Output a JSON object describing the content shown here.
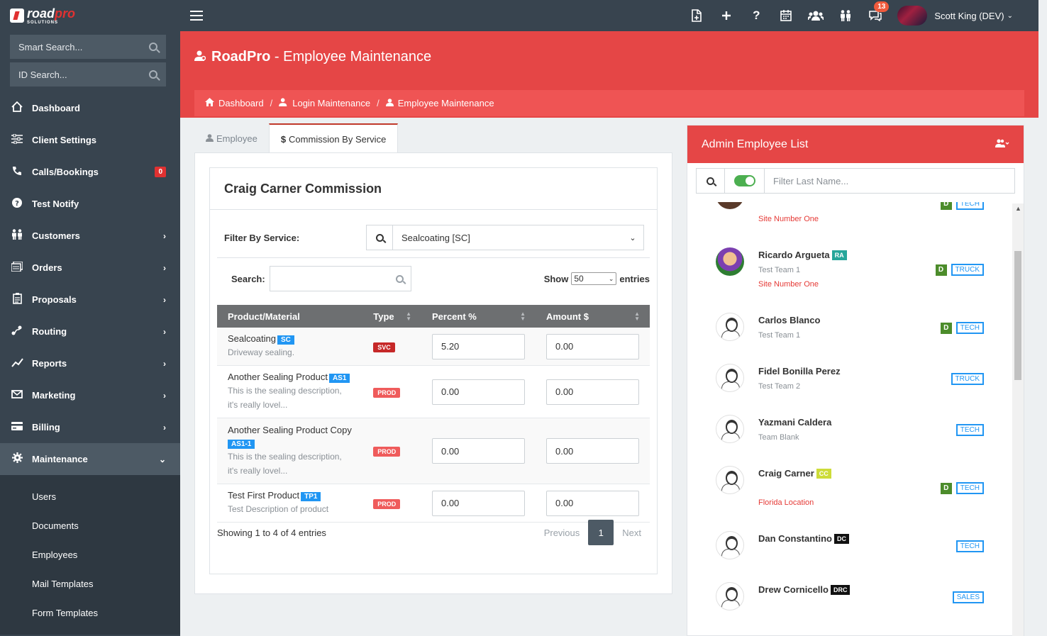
{
  "app": {
    "logo_main_a": "road",
    "logo_main_b": "pro",
    "logo_sub": "SOLUTIONS"
  },
  "topbar": {
    "notification_count": "13",
    "user_name": "Scott King (DEV)",
    "icons": [
      "new-document-icon",
      "plus-icon",
      "help-icon",
      "calendar-icon",
      "users-icon",
      "people-icon",
      "chat-icon"
    ]
  },
  "sidebar": {
    "smart_search": "Smart Search...",
    "id_search": "ID Search...",
    "items": [
      {
        "label": "Dashboard",
        "icon": "home-icon"
      },
      {
        "label": "Client Settings",
        "icon": "sliders-icon"
      },
      {
        "label": "Calls/Bookings",
        "icon": "phone-icon",
        "count": "0"
      },
      {
        "label": "Test Notify",
        "icon": "question-icon"
      },
      {
        "label": "Customers",
        "icon": "people-icon"
      },
      {
        "label": "Orders",
        "icon": "orders-icon"
      },
      {
        "label": "Proposals",
        "icon": "clipboard-icon"
      },
      {
        "label": "Routing",
        "icon": "route-icon"
      },
      {
        "label": "Reports",
        "icon": "chart-line-icon"
      },
      {
        "label": "Marketing",
        "icon": "envelope-icon"
      },
      {
        "label": "Billing",
        "icon": "credit-card-icon"
      },
      {
        "label": "Maintenance",
        "icon": "gear-icon"
      }
    ],
    "sub_items": [
      "Users",
      "Documents",
      "Employees",
      "Mail Templates",
      "Form Templates"
    ]
  },
  "header": {
    "title_brand": "RoadPro",
    "title_rest": " - Employee Maintenance",
    "breadcrumb": [
      "Dashboard",
      "Login Maintenance",
      "Employee Maintenance"
    ],
    "sep": "/"
  },
  "tabs": [
    {
      "label": "Employee"
    },
    {
      "label": "Commission By Service"
    }
  ],
  "commission": {
    "title": "Craig Carner Commission",
    "filter_label": "Filter By Service:",
    "filter_value": "Sealcoating [SC]",
    "search_label": "Search:",
    "show_label": "Show",
    "show_value": "50",
    "entries_label": "entries",
    "columns": [
      "Product/Material",
      "Type",
      "Percent %",
      "Amount $"
    ],
    "rows": [
      {
        "name": "Sealcoating",
        "code": "SC",
        "desc1": "Driveway sealing.",
        "desc2": "",
        "type": "SVC",
        "percent": "5.20",
        "amount": "0.00"
      },
      {
        "name": "Another Sealing Product",
        "code": "AS1",
        "desc1": "This is the sealing description,",
        "desc2": "it's really lovel...",
        "type": "PROD",
        "percent": "0.00",
        "amount": "0.00"
      },
      {
        "name": "Another Sealing Product Copy",
        "code": "AS1-1",
        "desc1": "This is the sealing description,",
        "desc2": "it's really lovel...",
        "type": "PROD",
        "percent": "0.00",
        "amount": "0.00"
      },
      {
        "name": "Test First Product",
        "code": "TP1",
        "desc1": "Test Description of product",
        "desc2": "",
        "type": "PROD",
        "percent": "0.00",
        "amount": "0.00"
      }
    ],
    "showing": "Showing 1 to 4 of 4 entries",
    "prev": "Previous",
    "page": "1",
    "next": "Next"
  },
  "employees": {
    "title": "Admin Employee List",
    "filter_placeholder": "Filter Last Name...",
    "list": [
      {
        "name": "",
        "initials": "",
        "team": "",
        "location": "Site Number One",
        "d": "D",
        "role": "TECH"
      },
      {
        "name": "Ricardo Argueta",
        "initials": "RA",
        "team": "Test Team 1",
        "location": "Site Number One",
        "d": "D",
        "role": "TRUCK"
      },
      {
        "name": "Carlos Blanco",
        "initials": "",
        "team": "Test Team 1",
        "location": "",
        "d": "D",
        "role": "TECH"
      },
      {
        "name": "Fidel Bonilla Perez",
        "initials": "",
        "team": "Test Team 2",
        "location": "",
        "d": "",
        "role": "TRUCK"
      },
      {
        "name": "Yazmani Caldera",
        "initials": "",
        "team": "Team Blank",
        "location": "",
        "d": "",
        "role": "TECH"
      },
      {
        "name": "Craig Carner",
        "initials": "CC",
        "team": "",
        "location": "Florida Location",
        "d": "D",
        "role": "TECH"
      },
      {
        "name": "Dan Constantino",
        "initials": "DC",
        "team": "",
        "location": "",
        "d": "",
        "role": "TECH"
      },
      {
        "name": "Drew Cornicello",
        "initials": "DRC",
        "team": "",
        "location": "",
        "d": "",
        "role": "SALES"
      }
    ]
  }
}
